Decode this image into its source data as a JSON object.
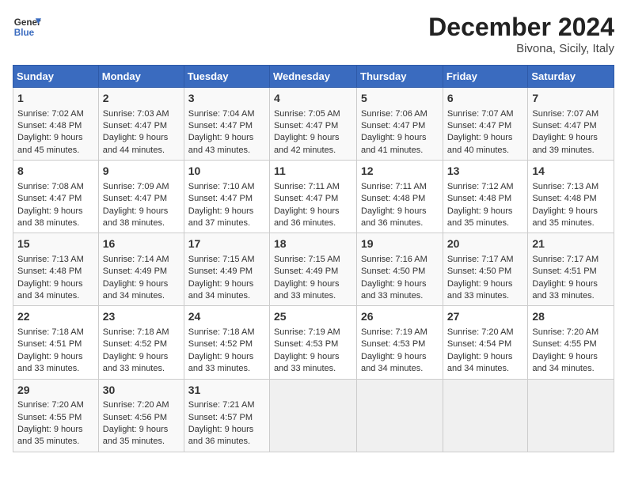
{
  "header": {
    "logo_general": "General",
    "logo_blue": "Blue",
    "title": "December 2024",
    "subtitle": "Bivona, Sicily, Italy"
  },
  "weekdays": [
    "Sunday",
    "Monday",
    "Tuesday",
    "Wednesday",
    "Thursday",
    "Friday",
    "Saturday"
  ],
  "weeks": [
    [
      {
        "day": "1",
        "sunrise": "7:02 AM",
        "sunset": "4:48 PM",
        "daylight": "9 hours and 45 minutes."
      },
      {
        "day": "2",
        "sunrise": "7:03 AM",
        "sunset": "4:47 PM",
        "daylight": "9 hours and 44 minutes."
      },
      {
        "day": "3",
        "sunrise": "7:04 AM",
        "sunset": "4:47 PM",
        "daylight": "9 hours and 43 minutes."
      },
      {
        "day": "4",
        "sunrise": "7:05 AM",
        "sunset": "4:47 PM",
        "daylight": "9 hours and 42 minutes."
      },
      {
        "day": "5",
        "sunrise": "7:06 AM",
        "sunset": "4:47 PM",
        "daylight": "9 hours and 41 minutes."
      },
      {
        "day": "6",
        "sunrise": "7:07 AM",
        "sunset": "4:47 PM",
        "daylight": "9 hours and 40 minutes."
      },
      {
        "day": "7",
        "sunrise": "7:07 AM",
        "sunset": "4:47 PM",
        "daylight": "9 hours and 39 minutes."
      }
    ],
    [
      {
        "day": "8",
        "sunrise": "7:08 AM",
        "sunset": "4:47 PM",
        "daylight": "9 hours and 38 minutes."
      },
      {
        "day": "9",
        "sunrise": "7:09 AM",
        "sunset": "4:47 PM",
        "daylight": "9 hours and 38 minutes."
      },
      {
        "day": "10",
        "sunrise": "7:10 AM",
        "sunset": "4:47 PM",
        "daylight": "9 hours and 37 minutes."
      },
      {
        "day": "11",
        "sunrise": "7:11 AM",
        "sunset": "4:47 PM",
        "daylight": "9 hours and 36 minutes."
      },
      {
        "day": "12",
        "sunrise": "7:11 AM",
        "sunset": "4:48 PM",
        "daylight": "9 hours and 36 minutes."
      },
      {
        "day": "13",
        "sunrise": "7:12 AM",
        "sunset": "4:48 PM",
        "daylight": "9 hours and 35 minutes."
      },
      {
        "day": "14",
        "sunrise": "7:13 AM",
        "sunset": "4:48 PM",
        "daylight": "9 hours and 35 minutes."
      }
    ],
    [
      {
        "day": "15",
        "sunrise": "7:13 AM",
        "sunset": "4:48 PM",
        "daylight": "9 hours and 34 minutes."
      },
      {
        "day": "16",
        "sunrise": "7:14 AM",
        "sunset": "4:49 PM",
        "daylight": "9 hours and 34 minutes."
      },
      {
        "day": "17",
        "sunrise": "7:15 AM",
        "sunset": "4:49 PM",
        "daylight": "9 hours and 34 minutes."
      },
      {
        "day": "18",
        "sunrise": "7:15 AM",
        "sunset": "4:49 PM",
        "daylight": "9 hours and 33 minutes."
      },
      {
        "day": "19",
        "sunrise": "7:16 AM",
        "sunset": "4:50 PM",
        "daylight": "9 hours and 33 minutes."
      },
      {
        "day": "20",
        "sunrise": "7:17 AM",
        "sunset": "4:50 PM",
        "daylight": "9 hours and 33 minutes."
      },
      {
        "day": "21",
        "sunrise": "7:17 AM",
        "sunset": "4:51 PM",
        "daylight": "9 hours and 33 minutes."
      }
    ],
    [
      {
        "day": "22",
        "sunrise": "7:18 AM",
        "sunset": "4:51 PM",
        "daylight": "9 hours and 33 minutes."
      },
      {
        "day": "23",
        "sunrise": "7:18 AM",
        "sunset": "4:52 PM",
        "daylight": "9 hours and 33 minutes."
      },
      {
        "day": "24",
        "sunrise": "7:18 AM",
        "sunset": "4:52 PM",
        "daylight": "9 hours and 33 minutes."
      },
      {
        "day": "25",
        "sunrise": "7:19 AM",
        "sunset": "4:53 PM",
        "daylight": "9 hours and 33 minutes."
      },
      {
        "day": "26",
        "sunrise": "7:19 AM",
        "sunset": "4:53 PM",
        "daylight": "9 hours and 34 minutes."
      },
      {
        "day": "27",
        "sunrise": "7:20 AM",
        "sunset": "4:54 PM",
        "daylight": "9 hours and 34 minutes."
      },
      {
        "day": "28",
        "sunrise": "7:20 AM",
        "sunset": "4:55 PM",
        "daylight": "9 hours and 34 minutes."
      }
    ],
    [
      {
        "day": "29",
        "sunrise": "7:20 AM",
        "sunset": "4:55 PM",
        "daylight": "9 hours and 35 minutes."
      },
      {
        "day": "30",
        "sunrise": "7:20 AM",
        "sunset": "4:56 PM",
        "daylight": "9 hours and 35 minutes."
      },
      {
        "day": "31",
        "sunrise": "7:21 AM",
        "sunset": "4:57 PM",
        "daylight": "9 hours and 36 minutes."
      },
      null,
      null,
      null,
      null
    ]
  ]
}
